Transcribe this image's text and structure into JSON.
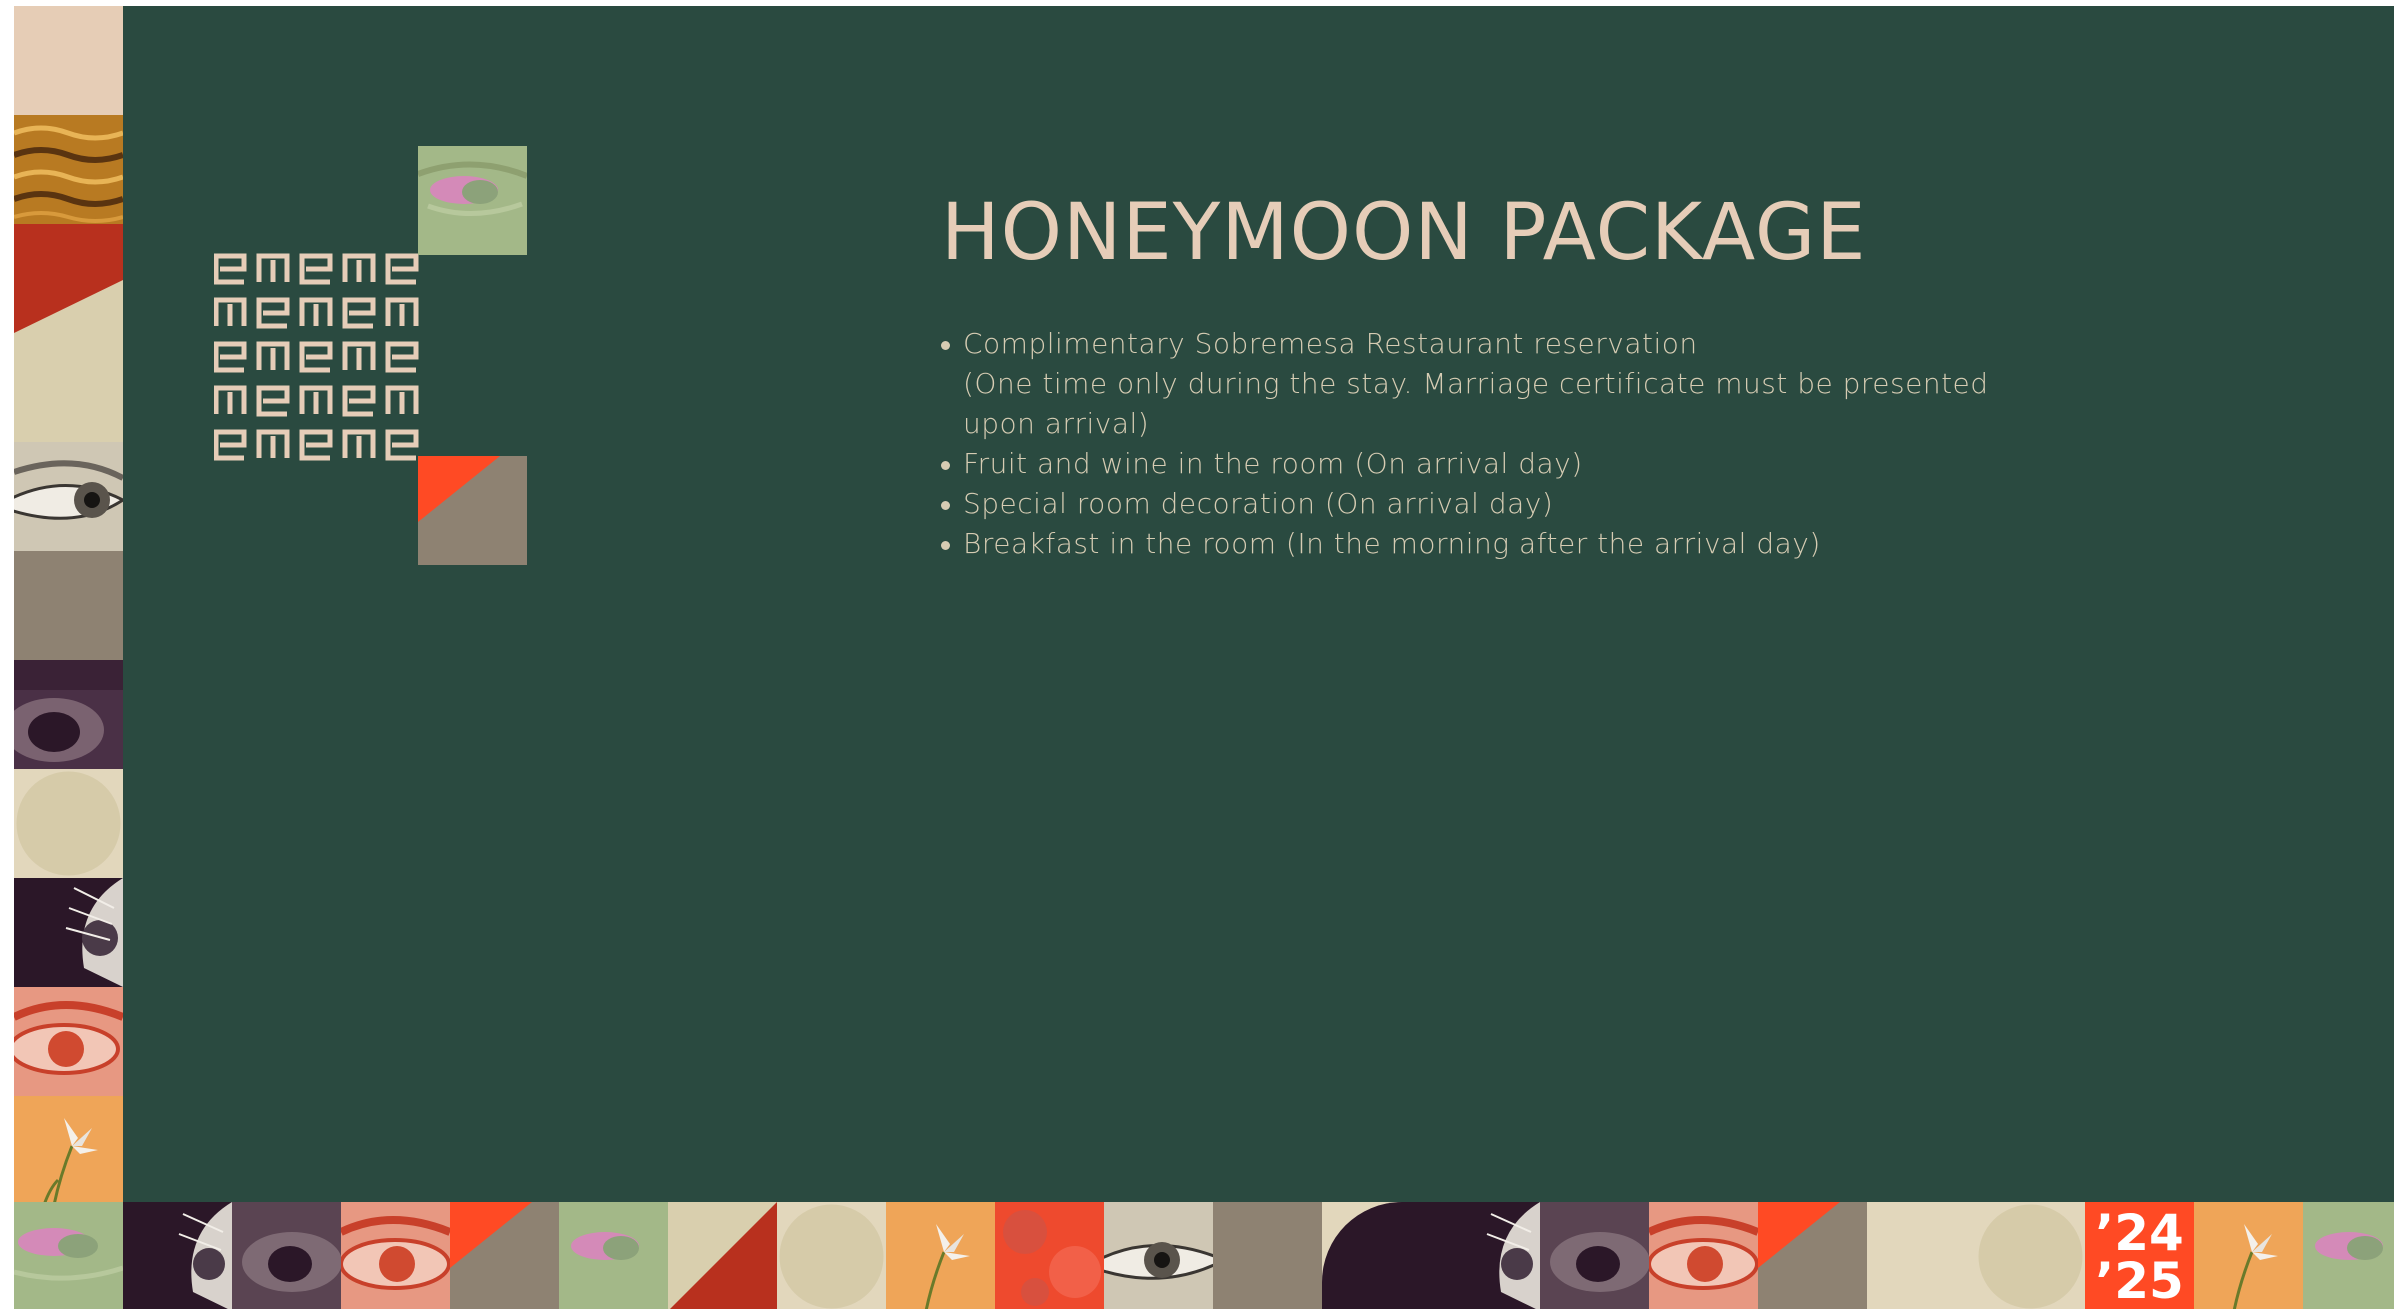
{
  "slide": {
    "title": "HONEYMOON PACKAGE",
    "benefits": [
      {
        "text": "Complimentary Sobremesa Restaurant reservation",
        "note": "(One time only during the stay. Marriage certificate must be presented upon arrival)"
      },
      {
        "text": "Fruit and wine in the room (On arrival day)"
      },
      {
        "text": "Special room decoration (On arrival day)"
      },
      {
        "text": "Breakfast in the room (In the morning after the arrival day)"
      }
    ]
  },
  "year_badge": {
    "line1": "’24",
    "line2": "’25"
  },
  "colors": {
    "background": "#2a4a40",
    "title": "#e6cdb8",
    "body_text": "#d6ccb3",
    "accent_red": "#ff4a24",
    "brick_red": "#b8301e",
    "cream": "#d9cfae",
    "taupe": "#8e8272",
    "plum": "#2b1728",
    "sage": "#a3b888",
    "orange": "#f0a55a"
  },
  "icons": {
    "logo": "repeated-e-glyph-logo",
    "tiles": [
      "eye-photo-icon",
      "water-photo-icon",
      "flower-photo-icon",
      "diagonal-triangle-icon",
      "circle-icon"
    ]
  }
}
